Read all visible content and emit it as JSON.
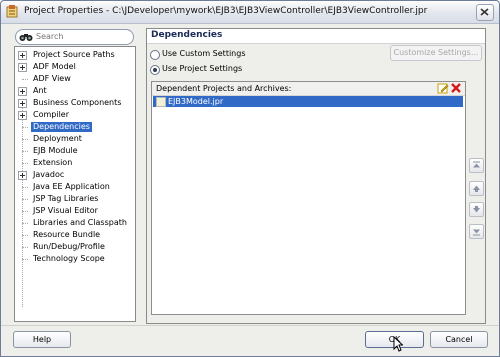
{
  "window": {
    "title": "Project Properties - C:\\JDeveloper\\mywork\\EJB3\\EJB3ViewController\\EJB3ViewController.jpr"
  },
  "search": {
    "placeholder": "Search"
  },
  "nav": {
    "items": [
      {
        "label": "Project Source Paths",
        "expandable": true
      },
      {
        "label": "ADF Model",
        "expandable": true
      },
      {
        "label": "ADF View",
        "expandable": false
      },
      {
        "label": "Ant",
        "expandable": true
      },
      {
        "label": "Business Components",
        "expandable": true
      },
      {
        "label": "Compiler",
        "expandable": true
      },
      {
        "label": "Dependencies",
        "expandable": false,
        "selected": true
      },
      {
        "label": "Deployment",
        "expandable": false
      },
      {
        "label": "EJB Module",
        "expandable": false
      },
      {
        "label": "Extension",
        "expandable": false
      },
      {
        "label": "Javadoc",
        "expandable": true
      },
      {
        "label": "Java EE Application",
        "expandable": false
      },
      {
        "label": "JSP Tag Libraries",
        "expandable": false
      },
      {
        "label": "JSP Visual Editor",
        "expandable": false
      },
      {
        "label": "Libraries and Classpath",
        "expandable": false
      },
      {
        "label": "Resource Bundle",
        "expandable": false
      },
      {
        "label": "Run/Debug/Profile",
        "expandable": false
      },
      {
        "label": "Technology Scope",
        "expandable": false
      }
    ]
  },
  "panel": {
    "title": "Dependencies",
    "radio_custom": "Use Custom Settings",
    "radio_project": "Use Project Settings",
    "selected_radio": "project",
    "customize_button": "Customize Settings...",
    "list_title": "Dependent Projects and Archives:",
    "rows": [
      "EJB3Model.jpr"
    ]
  },
  "footer": {
    "help": "Help",
    "ok": "OK",
    "cancel": "Cancel"
  },
  "colors": {
    "selection": "#3169c6",
    "title_blue": "#1b2b57"
  }
}
